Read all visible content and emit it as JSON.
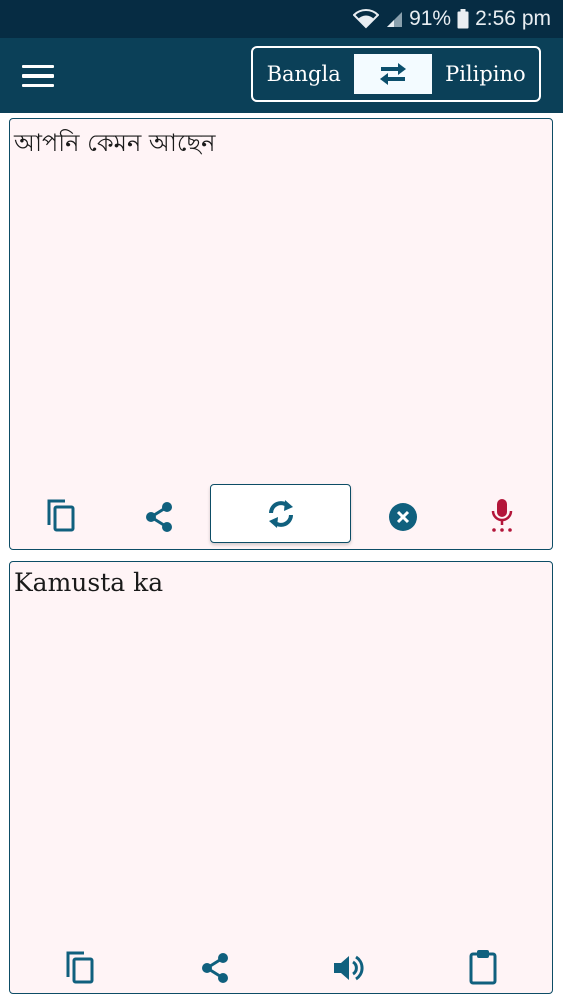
{
  "status_bar": {
    "battery": "91%",
    "time": "2:56 pm"
  },
  "toolbar": {
    "source_language": "Bangla",
    "target_language": "Pilipino",
    "icons": {
      "menu": "menu-icon",
      "swap": "swap-arrows-icon"
    }
  },
  "input_panel": {
    "text": "আপনি কেমন আছেন",
    "actions": [
      "copy-icon",
      "share-icon",
      "translate-refresh-icon",
      "clear-icon",
      "microphone-icon"
    ]
  },
  "output_panel": {
    "text": "Kamusta ka",
    "actions": [
      "copy-icon",
      "share-icon",
      "speaker-icon",
      "clipboard-icon"
    ]
  },
  "colors": {
    "status_bar": "#062c43",
    "toolbar": "#0b4058",
    "accent": "#10607e",
    "panel_bg": "#fff4f6",
    "mic": "#b3163a"
  }
}
